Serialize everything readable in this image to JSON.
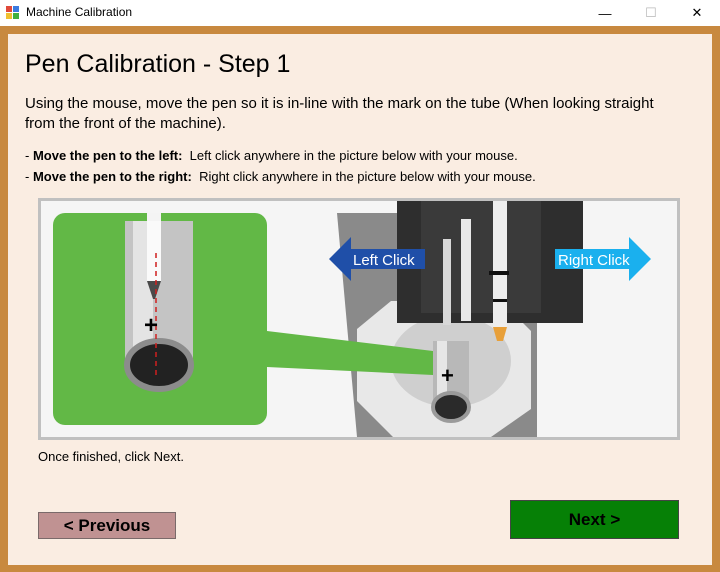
{
  "window": {
    "title": "Machine Calibration",
    "minimize_glyph": "—",
    "maximize_glyph": "☐",
    "close_glyph": "✕"
  },
  "page": {
    "heading": "Pen Calibration - Step 1",
    "intro": "Using the mouse, move the pen so it is in-line with the mark on the tube (When looking straight from the front of the machine).",
    "instructions": [
      {
        "bullet": "- ",
        "bold": "Move the pen to the left:",
        "text": "  Left click anywhere in the picture below with your mouse."
      },
      {
        "bullet": "- ",
        "bold": "Move the pen to the right:",
        "text": "  Right click anywhere in the picture below with your mouse."
      }
    ],
    "picture": {
      "left_label": "Left Click",
      "right_label": "Right Click"
    },
    "finished_text": "Once finished, click Next."
  },
  "buttons": {
    "previous_label": "< Previous",
    "next_label": "Next >"
  },
  "colors": {
    "left_arrow": "#1f4fa8",
    "right_arrow": "#1ab0ee",
    "inset_green": "#62b846",
    "next_button": "#068006",
    "previous_button": "#c09292"
  }
}
